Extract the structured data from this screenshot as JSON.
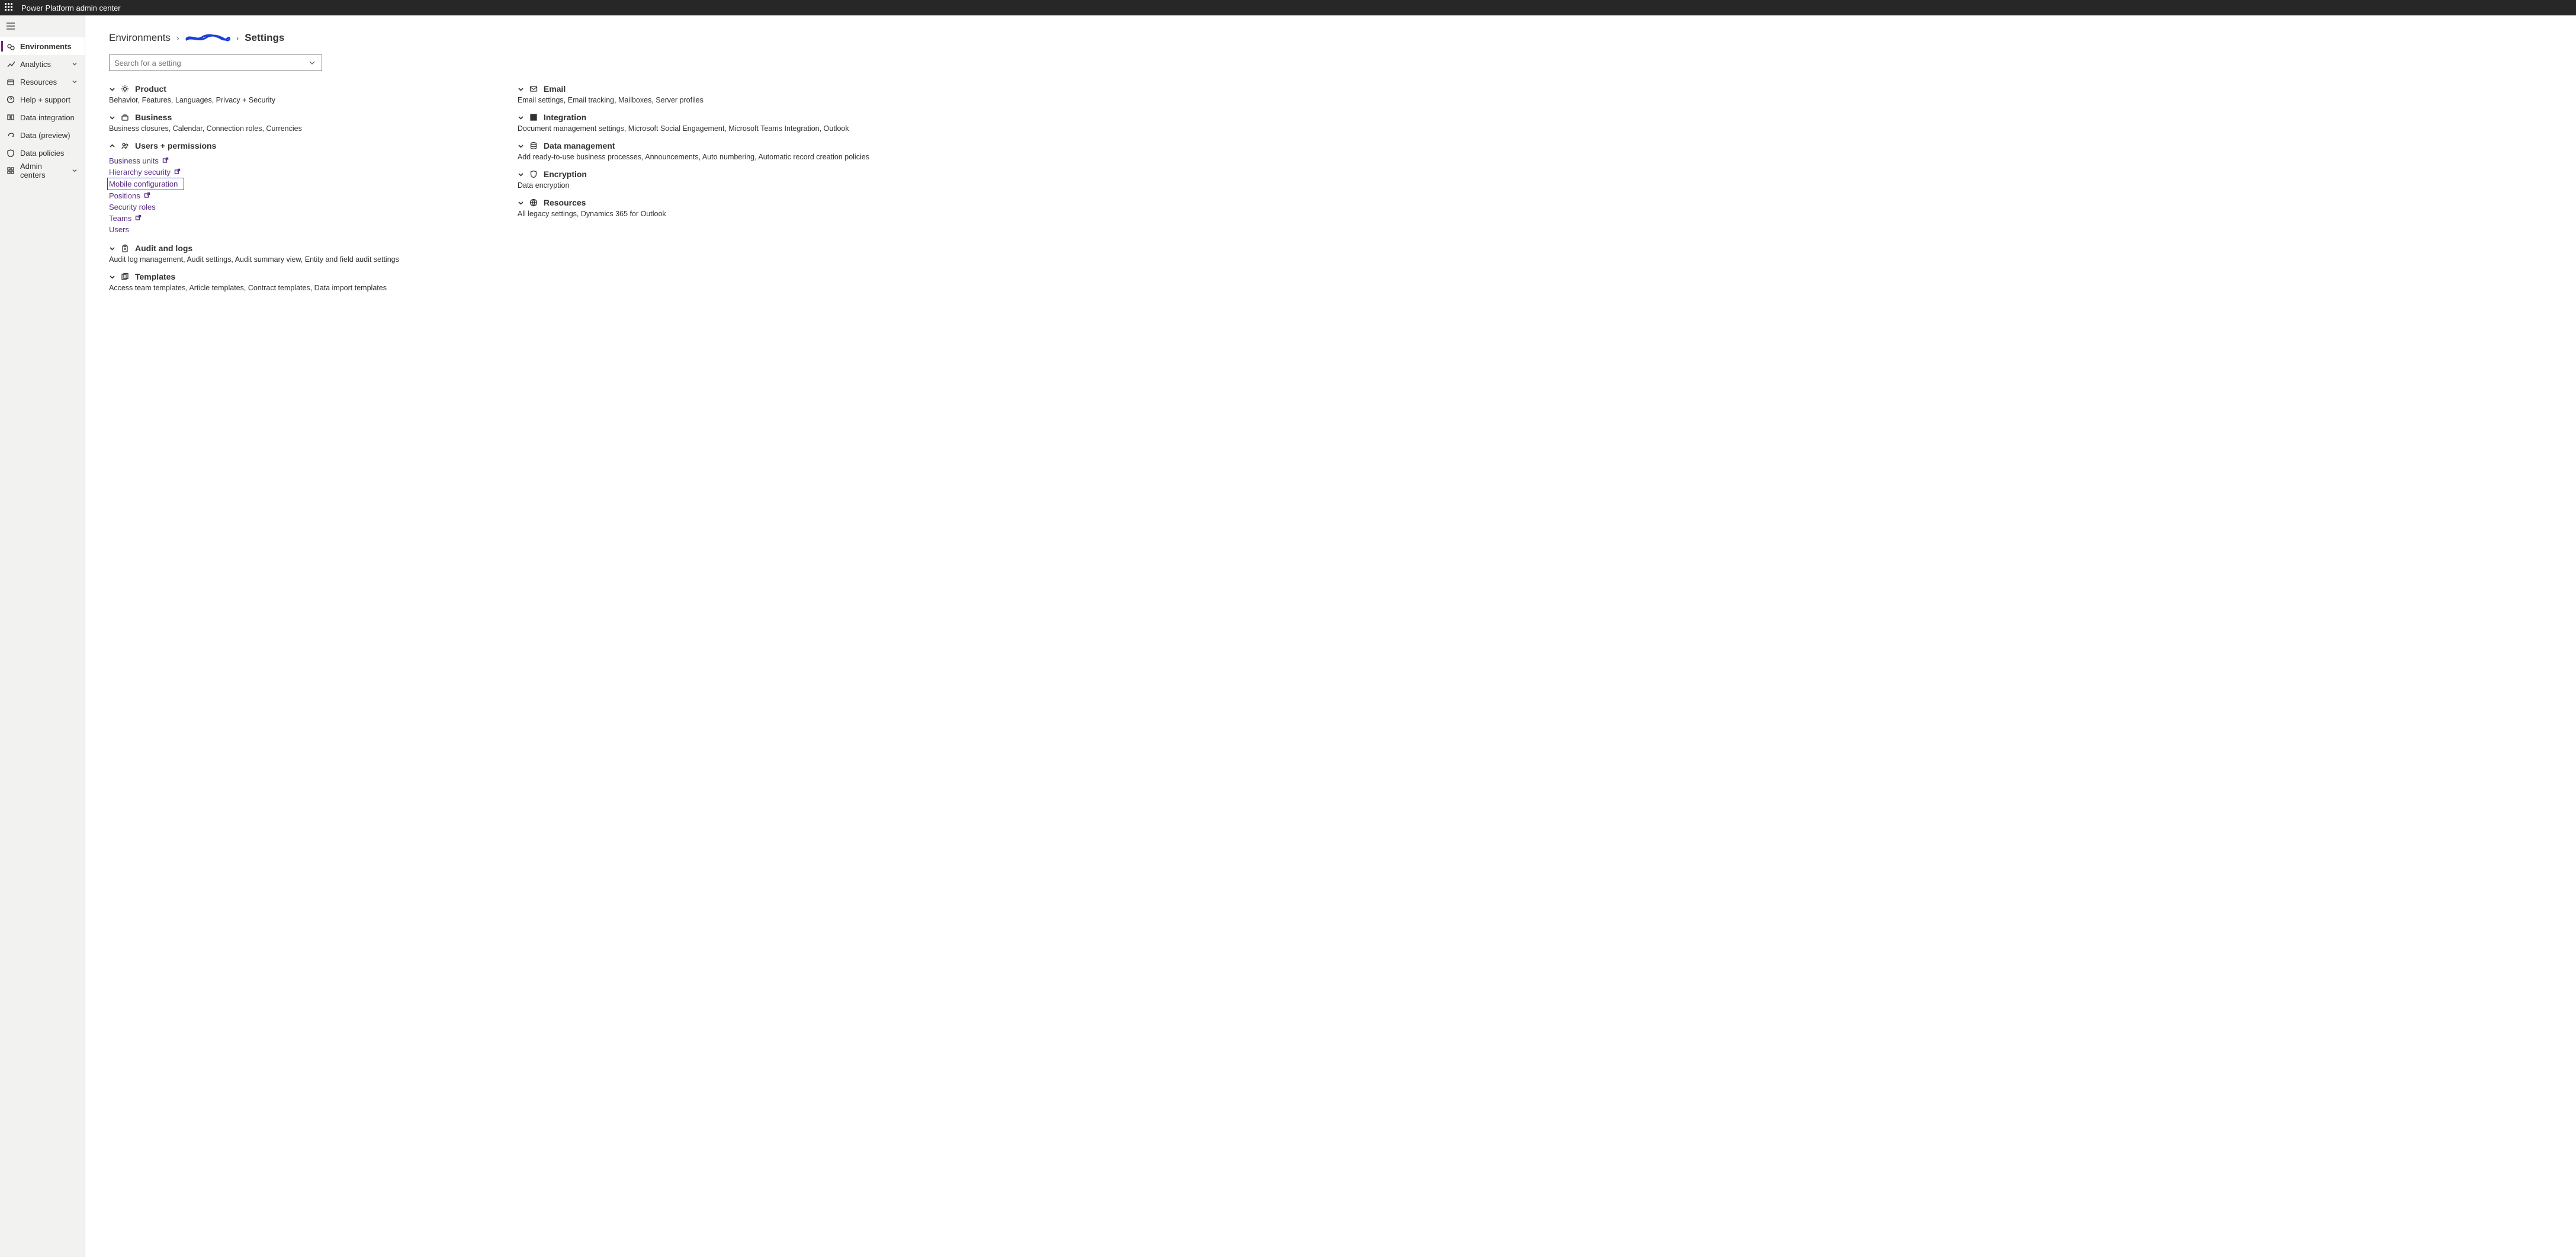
{
  "topbar": {
    "title": "Power Platform admin center"
  },
  "sidebar": {
    "items": [
      {
        "label": "Environments",
        "icon": "environments",
        "active": true,
        "expandable": false
      },
      {
        "label": "Analytics",
        "icon": "analytics",
        "active": false,
        "expandable": true
      },
      {
        "label": "Resources",
        "icon": "resources",
        "active": false,
        "expandable": true
      },
      {
        "label": "Help + support",
        "icon": "help",
        "active": false,
        "expandable": false
      },
      {
        "label": "Data integration",
        "icon": "dataintegration",
        "active": false,
        "expandable": false
      },
      {
        "label": "Data (preview)",
        "icon": "datapreview",
        "active": false,
        "expandable": false
      },
      {
        "label": "Data policies",
        "icon": "policies",
        "active": false,
        "expandable": false
      },
      {
        "label": "Admin centers",
        "icon": "admincenters",
        "active": false,
        "expandable": true
      }
    ]
  },
  "breadcrumb": {
    "root": "Environments",
    "current": "Settings",
    "redacted_color": "#1a3fd6"
  },
  "search": {
    "placeholder": "Search for a setting"
  },
  "left_groups": [
    {
      "title": "Product",
      "icon": "gear",
      "expanded": false,
      "desc": "Behavior, Features, Languages, Privacy + Security"
    },
    {
      "title": "Business",
      "icon": "briefcase",
      "expanded": false,
      "desc": "Business closures, Calendar, Connection roles, Currencies"
    },
    {
      "title": "Users + permissions",
      "icon": "people",
      "expanded": true,
      "sublinks": [
        {
          "label": "Business units",
          "ext": true,
          "highlight": false
        },
        {
          "label": "Hierarchy security",
          "ext": true,
          "highlight": false
        },
        {
          "label": "Mobile configuration",
          "ext": false,
          "highlight": true
        },
        {
          "label": "Positions",
          "ext": true,
          "highlight": false
        },
        {
          "label": "Security roles",
          "ext": false,
          "highlight": false
        },
        {
          "label": "Teams",
          "ext": true,
          "highlight": false
        },
        {
          "label": "Users",
          "ext": false,
          "highlight": false
        }
      ]
    },
    {
      "title": "Audit and logs",
      "icon": "clipboard",
      "expanded": false,
      "desc": "Audit log management, Audit settings, Audit summary view, Entity and field audit settings"
    },
    {
      "title": "Templates",
      "icon": "templates",
      "expanded": false,
      "desc": "Access team templates, Article templates, Contract templates, Data import templates"
    }
  ],
  "right_groups": [
    {
      "title": "Email",
      "icon": "mail",
      "expanded": false,
      "desc": "Email settings, Email tracking, Mailboxes, Server profiles"
    },
    {
      "title": "Integration",
      "icon": "windows",
      "expanded": false,
      "desc": "Document management settings, Microsoft Social Engagement, Microsoft Teams Integration, Outlook"
    },
    {
      "title": "Data management",
      "icon": "database",
      "expanded": false,
      "desc": "Add ready-to-use business processes, Announcements, Auto numbering, Automatic record creation policies"
    },
    {
      "title": "Encryption",
      "icon": "shield",
      "expanded": false,
      "desc": "Data encryption"
    },
    {
      "title": "Resources",
      "icon": "globe",
      "expanded": false,
      "desc": "All legacy settings, Dynamics 365 for Outlook"
    }
  ]
}
